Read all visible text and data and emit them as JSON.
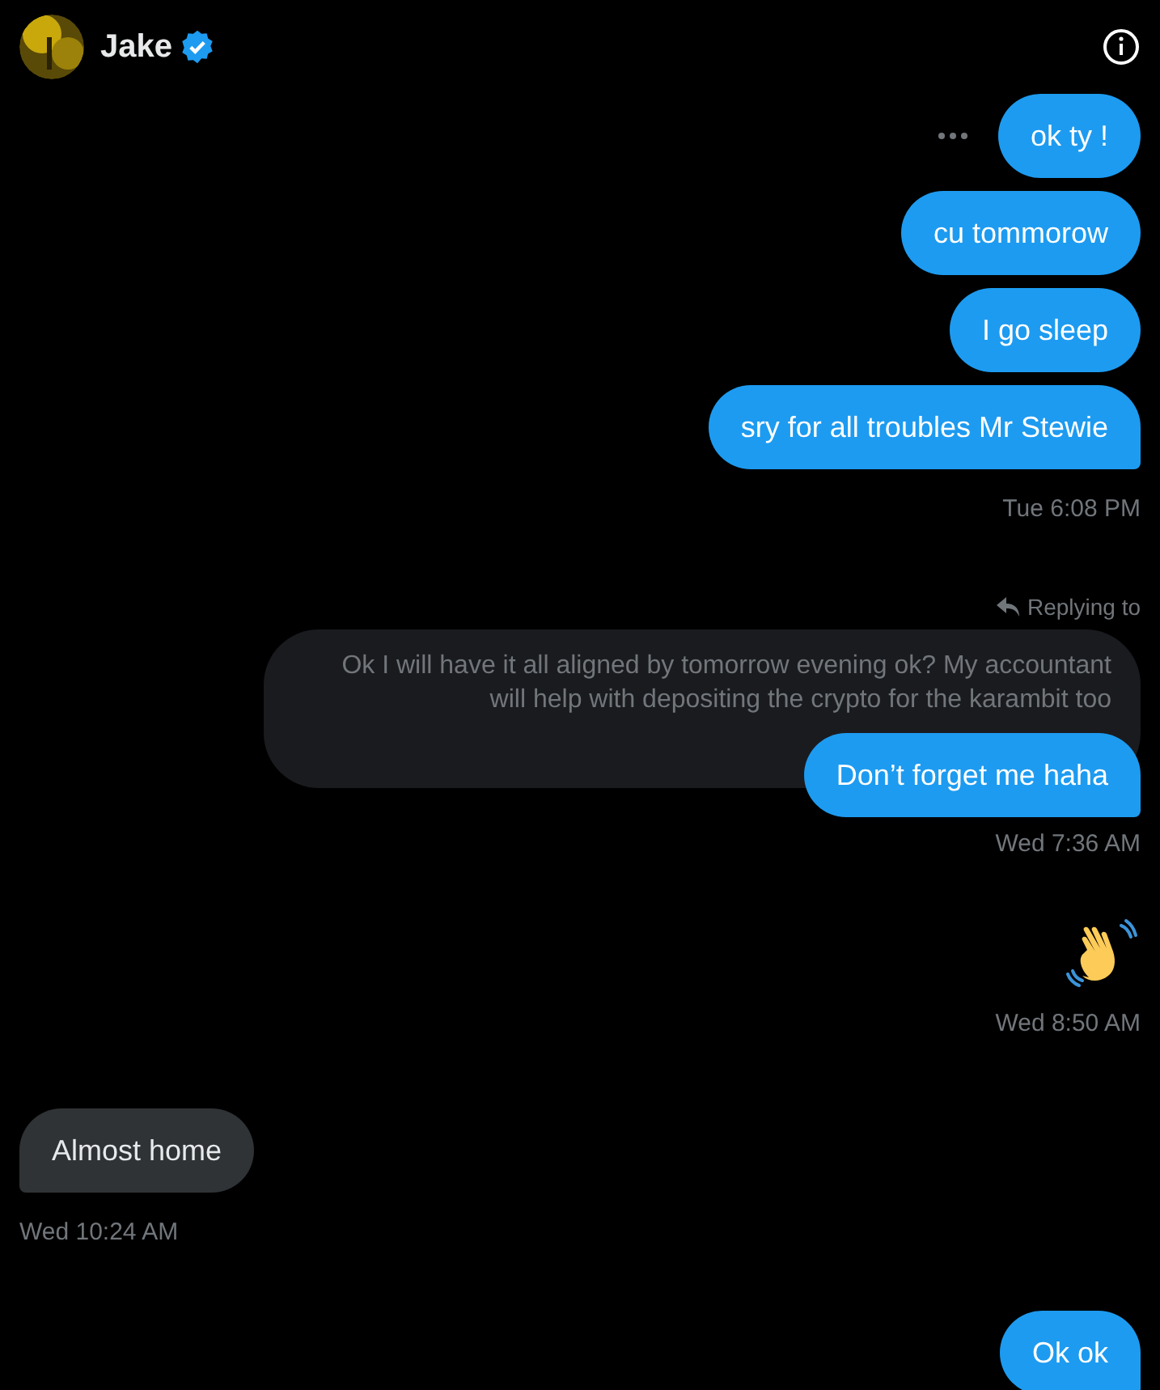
{
  "header": {
    "name": "Jake",
    "verified": true
  },
  "messages": [
    {
      "kind": "sent",
      "text": "ok ty !",
      "more": true,
      "tail": false
    },
    {
      "kind": "sent",
      "text": "cu tommorow",
      "more": false,
      "tail": false
    },
    {
      "kind": "sent",
      "text": "I go sleep",
      "more": false,
      "tail": false
    },
    {
      "kind": "sent",
      "text": "sry for all troubles Mr Stewie",
      "more": false,
      "tail": true
    },
    {
      "kind": "time",
      "text": "Tue 6:08 PM"
    },
    {
      "kind": "reply",
      "label": "Replying to",
      "quote": "Ok I will have it all aligned by tomorrow evening ok? My accountant will help with depositing the crypto for the karambit too",
      "text": "Don’t forget me haha",
      "tail": true
    },
    {
      "kind": "time",
      "text": "Wed 7:36 AM"
    },
    {
      "kind": "emoji"
    },
    {
      "kind": "time",
      "text": "Wed 8:50 AM"
    },
    {
      "kind": "received",
      "text": "Almost home",
      "tail": true
    },
    {
      "kind": "time",
      "text": "Wed 10:24 AM"
    },
    {
      "kind": "sent",
      "text": "Ok ok",
      "more": false,
      "tail": true
    }
  ]
}
